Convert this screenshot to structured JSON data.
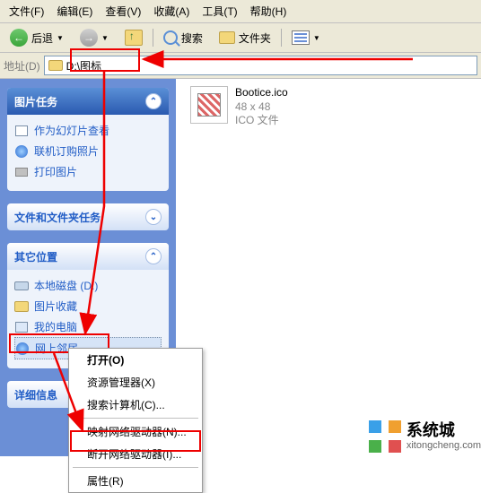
{
  "menu": {
    "file": "文件(F)",
    "edit": "编辑(E)",
    "view": "查看(V)",
    "fav": "收藏(A)",
    "tools": "工具(T)",
    "help": "帮助(H)"
  },
  "toolbar": {
    "back": "后退",
    "search": "搜索",
    "folders": "文件夹"
  },
  "addr": {
    "label": "地址(D)",
    "value": "D:\\图标"
  },
  "tasks": {
    "image_header": "图片任务",
    "slideshow": "作为幻灯片查看",
    "order": "联机订购照片",
    "print": "打印图片",
    "files_header": "文件和文件夹任务",
    "other_header": "其它位置",
    "disk": "本地磁盘 (D:)",
    "pictures": "图片收藏",
    "mypc": "我的电脑",
    "network": "网上邻居",
    "details_header": "详细信息"
  },
  "file": {
    "name": "Bootice.ico",
    "dims": "48 x 48",
    "type": "ICO 文件"
  },
  "ctx": {
    "open": "打开(O)",
    "explorer": "资源管理器(X)",
    "searchpc": "搜索计算机(C)...",
    "mapdrive": "映射网络驱动器(N)...",
    "disconnect": "断开网络驱动器(I)...",
    "properties": "属性(R)"
  },
  "watermark": {
    "brand": "系统城",
    "url": "xitongcheng.com"
  }
}
